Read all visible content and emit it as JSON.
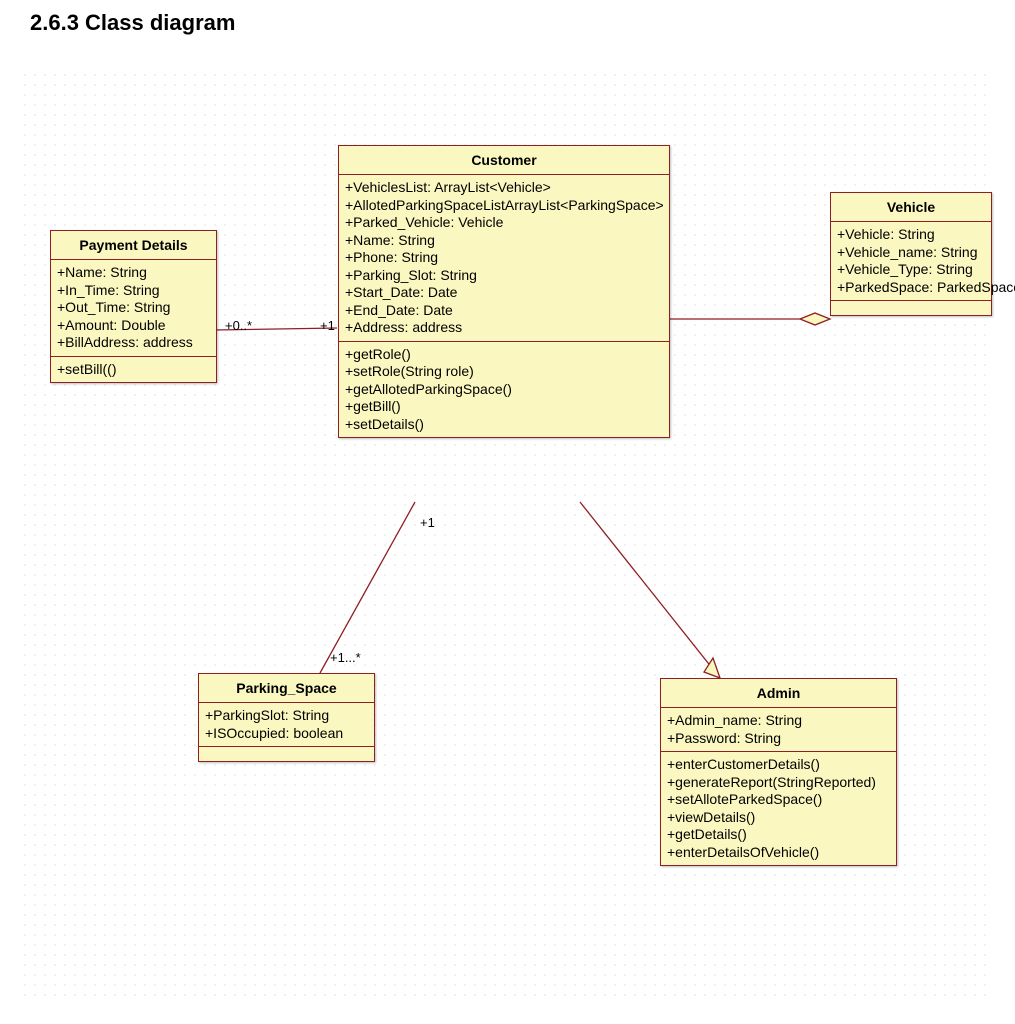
{
  "heading": "2.6.3 Class diagram",
  "classes": {
    "customer": {
      "name": "Customer",
      "attributes": [
        "+VehiclesList: ArrayList<Vehicle>",
        "+AllotedParkingSpaceListArrayList<ParkingSpace>",
        "+Parked_Vehicle: Vehicle",
        "+Name: String",
        "+Phone: String",
        "+Parking_Slot: String",
        "+Start_Date: Date",
        "+End_Date: Date",
        "+Address: address"
      ],
      "operations": [
        "+getRole()",
        "+setRole(String role)",
        "+getAllotedParkingSpace()",
        "+getBill()",
        "+setDetails()"
      ]
    },
    "payment": {
      "name": "Payment Details",
      "attributes": [
        "+Name: String",
        "+In_Time: String",
        "+Out_Time: String",
        "+Amount: Double",
        "+BillAddress: address"
      ],
      "operations": [
        "+setBill(()"
      ]
    },
    "vehicle": {
      "name": "Vehicle",
      "attributes": [
        "+Vehicle: String",
        "+Vehicle_name: String",
        "+Vehicle_Type: String",
        "+ParkedSpace: ParkedSpace"
      ],
      "operations": []
    },
    "parking": {
      "name": "Parking_Space",
      "attributes": [
        "+ParkingSlot: String",
        "+ISOccupied: boolean"
      ],
      "operations": []
    },
    "admin": {
      "name": "Admin",
      "attributes": [
        "+Admin_name: String",
        "+Password: String"
      ],
      "operations": [
        "+enterCustomerDetails()",
        "+generateReport(StringReported)",
        "+setAlloteParkedSpace()",
        "+viewDetails()",
        "+getDetails()",
        "+enterDetailsOfVehicle()"
      ]
    }
  },
  "multiplicities": {
    "payment_customer_left": "+0..*",
    "payment_customer_right": "+1",
    "customer_parking_top": "+1",
    "customer_parking_bottom": "+1...*"
  },
  "chart_data": {
    "type": "uml-class-diagram",
    "classes": [
      {
        "id": "Customer",
        "attributes": [
          "+VehiclesList: ArrayList<Vehicle>",
          "+AllotedParkingSpaceListArrayList<ParkingSpace>",
          "+Parked_Vehicle: Vehicle",
          "+Name: String",
          "+Phone: String",
          "+Parking_Slot: String",
          "+Start_Date: Date",
          "+End_Date: Date",
          "+Address: address"
        ],
        "operations": [
          "+getRole()",
          "+setRole(String role)",
          "+getAllotedParkingSpace()",
          "+getBill()",
          "+setDetails()"
        ]
      },
      {
        "id": "Payment Details",
        "attributes": [
          "+Name: String",
          "+In_Time: String",
          "+Out_Time: String",
          "+Amount: Double",
          "+BillAddress: address"
        ],
        "operations": [
          "+setBill(()"
        ]
      },
      {
        "id": "Vehicle",
        "attributes": [
          "+Vehicle: String",
          "+Vehicle_name: String",
          "+Vehicle_Type: String",
          "+ParkedSpace: ParkedSpace"
        ],
        "operations": []
      },
      {
        "id": "Parking_Space",
        "attributes": [
          "+ParkingSlot: String",
          "+ISOccupied: boolean"
        ],
        "operations": []
      },
      {
        "id": "Admin",
        "attributes": [
          "+Admin_name: String",
          "+Password: String"
        ],
        "operations": [
          "+enterCustomerDetails()",
          "+generateReport(StringReported)",
          "+setAlloteParkedSpace()",
          "+viewDetails()",
          "+getDetails()",
          "+enterDetailsOfVehicle()"
        ]
      }
    ],
    "relationships": [
      {
        "from": "Payment Details",
        "to": "Customer",
        "type": "association",
        "from_mult": "0..*",
        "to_mult": "1"
      },
      {
        "from": "Customer",
        "to": "Vehicle",
        "type": "aggregation",
        "aggregate_at": "Vehicle"
      },
      {
        "from": "Customer",
        "to": "Parking_Space",
        "type": "association",
        "from_mult": "1",
        "to_mult": "1..*"
      },
      {
        "from": "Admin",
        "to": "Customer",
        "type": "generalization",
        "parent": "Customer"
      }
    ]
  }
}
